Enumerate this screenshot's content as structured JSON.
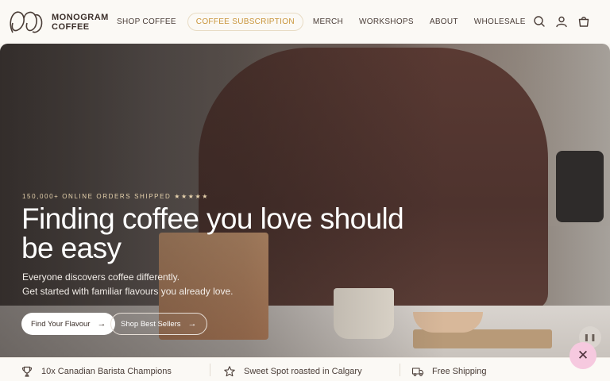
{
  "brand": {
    "name_line1": "MONOGRAM",
    "name_line2": "COFFEE"
  },
  "nav": {
    "items": [
      {
        "label": "SHOP COFFEE"
      },
      {
        "label": "COFFEE SUBSCRIPTION",
        "active": true
      },
      {
        "label": "MERCH"
      },
      {
        "label": "WORKSHOPS"
      },
      {
        "label": "ABOUT"
      },
      {
        "label": "WHOLESALE"
      }
    ]
  },
  "header_icons": [
    "search-icon",
    "account-icon",
    "cart-icon"
  ],
  "hero": {
    "kicker": "150,000+ ONLINE ORDERS SHIPPED ★★★★★",
    "headline": "Finding coffee you love should be easy",
    "subtext_line1": "Everyone discovers coffee differently.",
    "subtext_line2": "Get started with familiar flavours you already love.",
    "primary_button": "Find Your Flavour",
    "secondary_button": "Shop Best Sellers"
  },
  "trust_bar": {
    "items": [
      {
        "icon": "trophy-icon",
        "label": "10x Canadian Barista Champions"
      },
      {
        "icon": "star-icon",
        "label": "Sweet Spot roasted in Calgary"
      },
      {
        "icon": "truck-icon",
        "label": "Free Shipping"
      }
    ]
  },
  "colors": {
    "accent": "#c9953a",
    "fab": "#f6c9df",
    "background": "#fbf9f5"
  }
}
